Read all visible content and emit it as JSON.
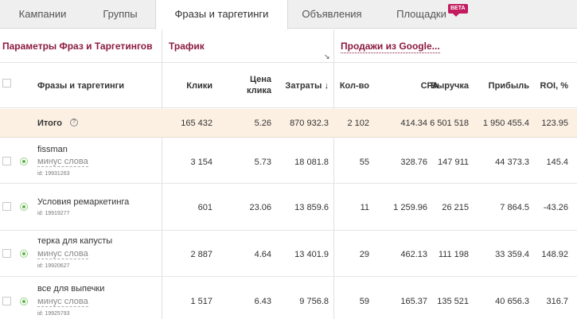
{
  "tabs": [
    {
      "label": "Кампании"
    },
    {
      "label": "Группы"
    },
    {
      "label": "Фразы и таргетинги",
      "active": true
    },
    {
      "label": "Объявления"
    },
    {
      "label": "Площадки"
    }
  ],
  "beta_label": "BETA",
  "groups": {
    "params": "Параметры Фраз и Таргетингов",
    "traffic": "Трафик",
    "sales": "Продажи из Google..."
  },
  "columns": {
    "phrases": "Фразы и таргетинги",
    "clicks": "Клики",
    "price_line1": "Цена",
    "price_line2": "клика",
    "cost": "Затраты",
    "count": "Кол-во",
    "cpa": "CPA",
    "revenue": "Выручка",
    "profit": "Прибыль",
    "roi": "ROI, %"
  },
  "total": {
    "label": "Итого",
    "clicks": "165 432",
    "price": "5.26",
    "cost": "870 932.3",
    "count": "2 102",
    "cpa": "414.34",
    "revenue": "6 501 518",
    "profit": "1 950 455.4",
    "roi": "123.95"
  },
  "rows": [
    {
      "name": "fissman",
      "minus": "минус слова",
      "id": "id: 19931263",
      "clicks": "3 154",
      "price": "5.73",
      "cost": "18 081.8",
      "count": "55",
      "cpa": "328.76",
      "revenue": "147 911",
      "profit": "44 373.3",
      "roi": "145.4"
    },
    {
      "name": "Условия ремаркетинга",
      "minus": "",
      "id": "id: 19919277",
      "clicks": "601",
      "price": "23.06",
      "cost": "13 859.6",
      "count": "11",
      "cpa": "1 259.96",
      "revenue": "26 215",
      "profit": "7 864.5",
      "roi": "-43.26"
    },
    {
      "name": "терка для капусты",
      "minus": "минус слова",
      "id": "id: 19920627",
      "clicks": "2 887",
      "price": "4.64",
      "cost": "13 401.9",
      "count": "29",
      "cpa": "462.13",
      "revenue": "111 198",
      "profit": "33 359.4",
      "roi": "148.92"
    },
    {
      "name": "все для выпечки",
      "minus": "минус слова",
      "id": "id: 19925793",
      "clicks": "1 517",
      "price": "6.43",
      "cost": "9 756.8",
      "count": "59",
      "cpa": "165.37",
      "revenue": "135 521",
      "profit": "40 656.3",
      "roi": "316.7"
    }
  ]
}
